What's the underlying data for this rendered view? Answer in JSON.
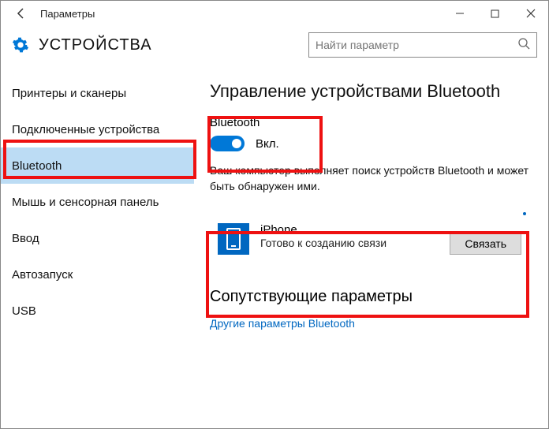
{
  "window": {
    "title": "Параметры"
  },
  "header": {
    "section": "УСТРОЙСТВА",
    "search_placeholder": "Найти параметр"
  },
  "sidebar": {
    "items": [
      {
        "label": "Принтеры и сканеры"
      },
      {
        "label": "Подключенные устройства"
      },
      {
        "label": "Bluetooth"
      },
      {
        "label": "Мышь и сенсорная панель"
      },
      {
        "label": "Ввод"
      },
      {
        "label": "Автозапуск"
      },
      {
        "label": "USB"
      }
    ],
    "selected_index": 2
  },
  "content": {
    "heading": "Управление устройствами Bluetooth",
    "toggle_title": "Bluetooth",
    "toggle_state_label": "Вкл.",
    "toggle_on": true,
    "description": "Ваш компьютер выполняет поиск устройств Bluetooth и может быть обнаружен ими.",
    "device": {
      "name": "iPhone",
      "status": "Готово к созданию связи",
      "pair_label": "Связать"
    },
    "related_heading": "Сопутствующие параметры",
    "related_link": "Другие параметры Bluetooth"
  }
}
